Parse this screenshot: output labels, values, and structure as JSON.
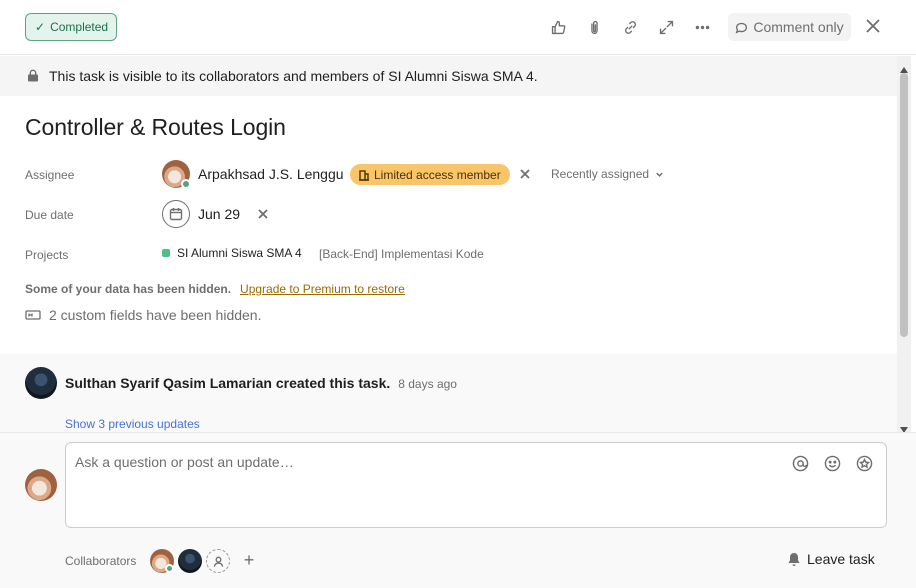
{
  "toolbar": {
    "status_label": "Completed",
    "comment_only_label": "Comment only",
    "icons": [
      "thumbs-up-icon",
      "paperclip-icon",
      "link-icon",
      "expand-icon",
      "more-icon",
      "close-icon"
    ]
  },
  "banner": {
    "text": "This task is visible to its collaborators and members of SI Alumni Siswa SMA 4."
  },
  "task": {
    "title": "Controller & Routes Login"
  },
  "fields": {
    "assignee_label": "Assignee",
    "assignee_name": "Arpakhsad J.S. Lenggu",
    "assignee_badge": "Limited access member",
    "recently_assigned": "Recently assigned",
    "due_label": "Due date",
    "due_value": "Jun 29",
    "projects_label": "Projects",
    "project_name": "SI Alumni Siswa SMA 4",
    "project_section": "[Back-End] Implementasi Kode",
    "hidden_notice": "Some of your data has been hidden.",
    "upgrade_link": "Upgrade to Premium to restore",
    "custom_fields_hidden": "2 custom fields have been hidden."
  },
  "activity": {
    "actor": "Sulthan Syarif Qasim Lamarian",
    "action": "created this task.",
    "time": "8 days ago",
    "show_previous": "Show 3 previous updates"
  },
  "composer": {
    "placeholder": "Ask a question or post an update…",
    "collaborators_label": "Collaborators",
    "add_label": "+",
    "leave_task_label": "Leave task"
  },
  "colors": {
    "completed_bg": "#e3f4ec",
    "completed_border": "#5da283",
    "limited_badge": "#f8c56a",
    "project_dot": "#4fbe88",
    "link_blue": "#4573d2",
    "upgrade_link": "#9a6b00"
  }
}
